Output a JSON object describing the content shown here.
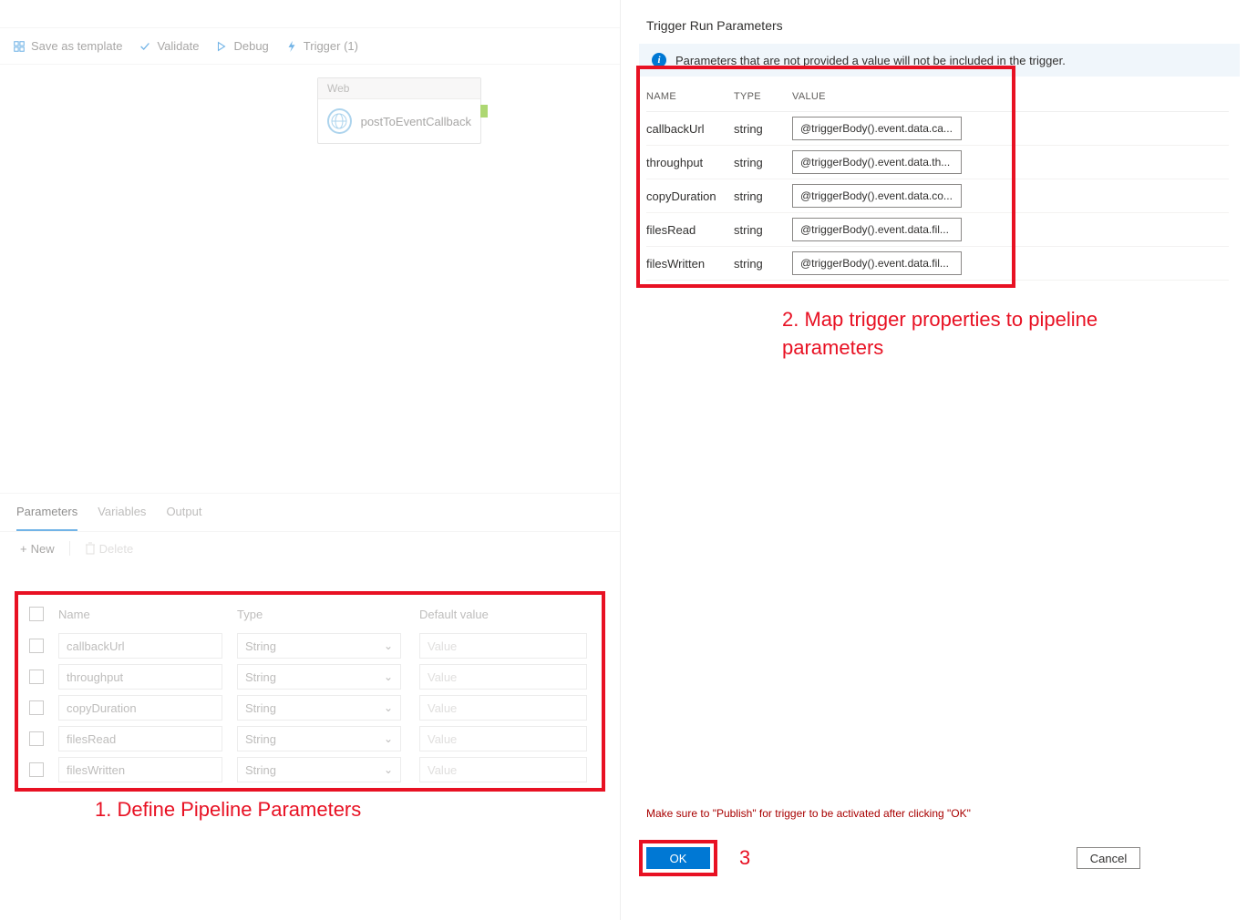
{
  "toolbar": {
    "save": "Save as template",
    "validate": "Validate",
    "debug": "Debug",
    "trigger": "Trigger (1)"
  },
  "node": {
    "header": "Web",
    "label": "postToEventCallback"
  },
  "tabs": {
    "parameters": "Parameters",
    "variables": "Variables",
    "output": "Output"
  },
  "panelActions": {
    "new": "New",
    "delete": "Delete"
  },
  "paramHeaders": {
    "name": "Name",
    "type": "Type",
    "default": "Default value"
  },
  "paramDefaultPlaceholder": "Value",
  "parameters": [
    {
      "name": "callbackUrl",
      "type": "String"
    },
    {
      "name": "throughput",
      "type": "String"
    },
    {
      "name": "copyDuration",
      "type": "String"
    },
    {
      "name": "filesRead",
      "type": "String"
    },
    {
      "name": "filesWritten",
      "type": "String"
    }
  ],
  "right": {
    "title": "Trigger Run Parameters",
    "info": "Parameters that are not provided a value will not be included in the trigger.",
    "headers": {
      "name": "NAME",
      "type": "TYPE",
      "value": "VALUE"
    },
    "rows": [
      {
        "name": "callbackUrl",
        "type": "string",
        "value": "@triggerBody().event.data.ca..."
      },
      {
        "name": "throughput",
        "type": "string",
        "value": "@triggerBody().event.data.th..."
      },
      {
        "name": "copyDuration",
        "type": "string",
        "value": "@triggerBody().event.data.co..."
      },
      {
        "name": "filesRead",
        "type": "string",
        "value": "@triggerBody().event.data.fil..."
      },
      {
        "name": "filesWritten",
        "type": "string",
        "value": "@triggerBody().event.data.fil..."
      }
    ],
    "publishNote": "Make sure to \"Publish\" for trigger to be activated after clicking \"OK\"",
    "ok": "OK",
    "cancel": "Cancel"
  },
  "annotations": {
    "a1": "1. Define Pipeline Parameters",
    "a2": "2. Map trigger properties to pipeline parameters",
    "a3": "3"
  }
}
